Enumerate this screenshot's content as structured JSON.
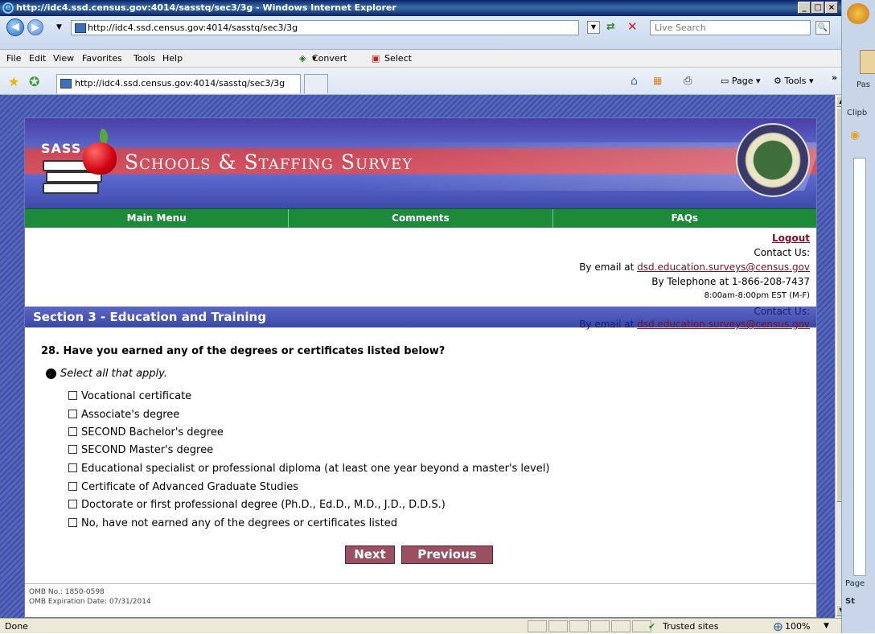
{
  "window": {
    "title": "http://idc4.ssd.census.gov:4014/sasstq/sec3/3g - Windows Internet Explorer",
    "minimize": "_",
    "restore": "□",
    "close": "×"
  },
  "browser": {
    "address": "http://idc4.ssd.census.gov:4014/sasstq/sec3/3g",
    "search_placeholder": "Live Search",
    "menu": [
      "File",
      "Edit",
      "View",
      "Favorites",
      "Tools",
      "Help"
    ],
    "convert_label": "Convert",
    "select_label": "Select",
    "tab_label": "http://idc4.ssd.census.gov:4014/sasstq/sec3/3g",
    "page_menu": "Page",
    "tools_menu": "Tools",
    "status_text": "Done",
    "zone": "Trusted sites",
    "zoom": "100%"
  },
  "header": {
    "logo_text": "SASS",
    "title": "Schools & Staffing Survey",
    "seal_text": "DEPARTMENT OF EDUCATION · UNITED STATES OF AMERICA"
  },
  "nav": {
    "items": [
      "Main Menu",
      "Comments",
      "FAQs"
    ]
  },
  "contact": {
    "logout": "Logout",
    "contact_us": "Contact Us:",
    "email_prefix": "By email at",
    "email": "dsd.education.surveys@census.gov",
    "phone": "By Telephone at 1-866-208-7437",
    "hours": "8:00am-8:00pm EST (M-F)"
  },
  "section": {
    "title": "Section 3 - Education and Training"
  },
  "question": {
    "text": "28. Have you earned any of the degrees or certificates listed below?",
    "instruction": "Select all that apply.",
    "options": [
      "Vocational certificate",
      "Associate's degree",
      "SECOND Bachelor's degree",
      "SECOND Master's degree",
      "Educational specialist or professional diploma (at least one year beyond a master's level)",
      "Certificate of Advanced Graduate Studies",
      "Doctorate or first professional degree (Ph.D., Ed.D., M.D., J.D., D.D.S.)",
      "No, have not earned any of the degrees or certificates listed"
    ]
  },
  "buttons": {
    "next": "Next",
    "previous": "Previous"
  },
  "footer": {
    "omb_no": "OMB No.: 1850-0598",
    "omb_exp": "OMB Expiration Date: 07/31/2014"
  },
  "side_pane": {
    "paste": "Pas",
    "clipboard": "Clipb",
    "page": "Page",
    "start": "St"
  }
}
